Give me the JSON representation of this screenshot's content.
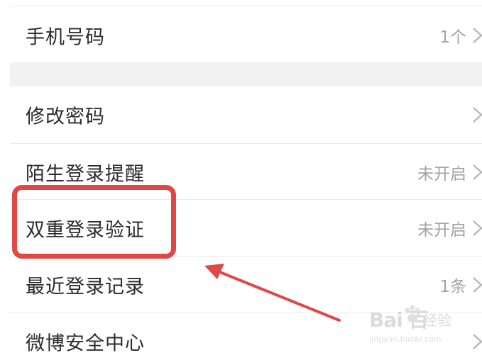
{
  "settings": {
    "rows": [
      {
        "label": "手机号码",
        "value": "1个"
      },
      {
        "label": "修改密码",
        "value": ""
      },
      {
        "label": "陌生登录提醒",
        "value": "未开启"
      },
      {
        "label": "双重登录验证",
        "value": "未开启"
      },
      {
        "label": "最近登录记录",
        "value": "1条"
      },
      {
        "label": "微博安全中心",
        "value": ""
      }
    ]
  },
  "annotation": {
    "highlight_color": "#e04848",
    "arrow_color": "#e04848",
    "highlighted_row": "双重登录验证"
  },
  "watermark": {
    "logo_text": "Bai 百",
    "suffix": "经验",
    "url": "jingyan.baidu.com"
  },
  "colors": {
    "label": "#2b2b2b",
    "value": "#a3a3a3",
    "section_gap": "#f2f2f2",
    "divider": "#ececec"
  }
}
